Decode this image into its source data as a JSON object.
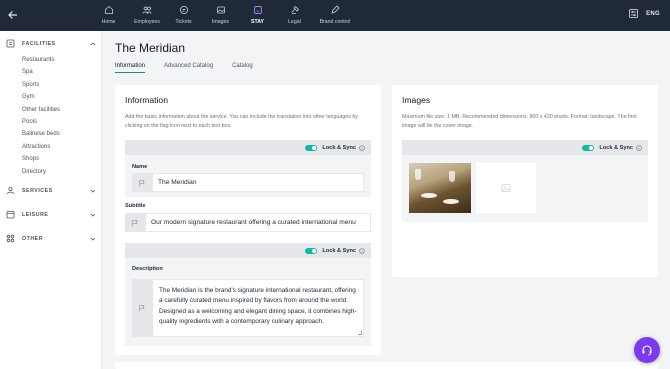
{
  "nav": {
    "items": [
      {
        "label": "Home",
        "icon": "home-icon"
      },
      {
        "label": "Employees",
        "icon": "employees-icon"
      },
      {
        "label": "Tickets",
        "icon": "tickets-icon"
      },
      {
        "label": "Images",
        "icon": "images-icon"
      },
      {
        "label": "STAY",
        "icon": "stay-icon",
        "active": true
      },
      {
        "label": "Legal",
        "icon": "legal-icon"
      },
      {
        "label": "Brand control",
        "icon": "brand-control-icon"
      }
    ],
    "language": "ENG"
  },
  "sidebar": {
    "facilities": {
      "title": "FACILITIES",
      "items": [
        "Restaurants",
        "Spa",
        "Sports",
        "Gym",
        "Other facilities",
        "Pools",
        "Balinese beds",
        "Attractions",
        "Shops",
        "Directory"
      ]
    },
    "services": {
      "title": "SERVICES"
    },
    "leisure": {
      "title": "LEISURE"
    },
    "other": {
      "title": "OTHER"
    }
  },
  "page": {
    "title": "The Meridian",
    "tabs": [
      "Information",
      "Advanced Catalog",
      "Catalog"
    ],
    "active_tab": "Information"
  },
  "information": {
    "title": "Information",
    "description": "Add the basic information about the service. You can include the translation into other languages by clicking on the flag icon next to each text box.",
    "lock_label": "Lock & Sync",
    "name_label": "Name",
    "name_value": "The Meridian",
    "subtitle_label": "Subtitle",
    "subtitle_value": "Our modern signature restaurant offering a curated international menu",
    "description_label": "Description",
    "description_value": "The Meridian is the brand's signature international restaurant, offering a carefully curated menu inspired by flavors from around the world. Designed as a welcoming and elegant dining space, it combines high-quality ingredients with a contemporary culinary approach."
  },
  "images": {
    "title": "Images",
    "description": "Maximum file size: 1 MB. Recommended dimensions: 800 x 420 pixels. Format: landscape. The first image will be the cover image.",
    "lock_label": "Lock & Sync"
  },
  "colors": {
    "topbar": "#1f2937",
    "accent": "#14b8a6",
    "fab": "#7c3aed"
  }
}
